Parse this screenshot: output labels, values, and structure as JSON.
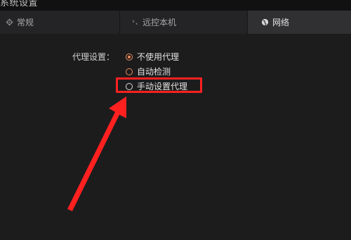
{
  "window": {
    "title": "系统设置"
  },
  "tabs": [
    {
      "label": "常规",
      "icon": "gear-icon",
      "active": false
    },
    {
      "label": "远控本机",
      "icon": "remote-icon",
      "active": false
    },
    {
      "label": "网络",
      "icon": "globe-icon",
      "active": true
    }
  ],
  "proxy": {
    "label": "代理设置：",
    "options": [
      {
        "label": "不使用代理",
        "selected": true
      },
      {
        "label": "自动检测",
        "selected": false
      },
      {
        "label": "手动设置代理",
        "selected": false
      }
    ]
  },
  "colors": {
    "accent": "#ee8b5c",
    "annotation": "#ff2020",
    "background": "#1c1c1d",
    "active_tab": "#303033"
  }
}
